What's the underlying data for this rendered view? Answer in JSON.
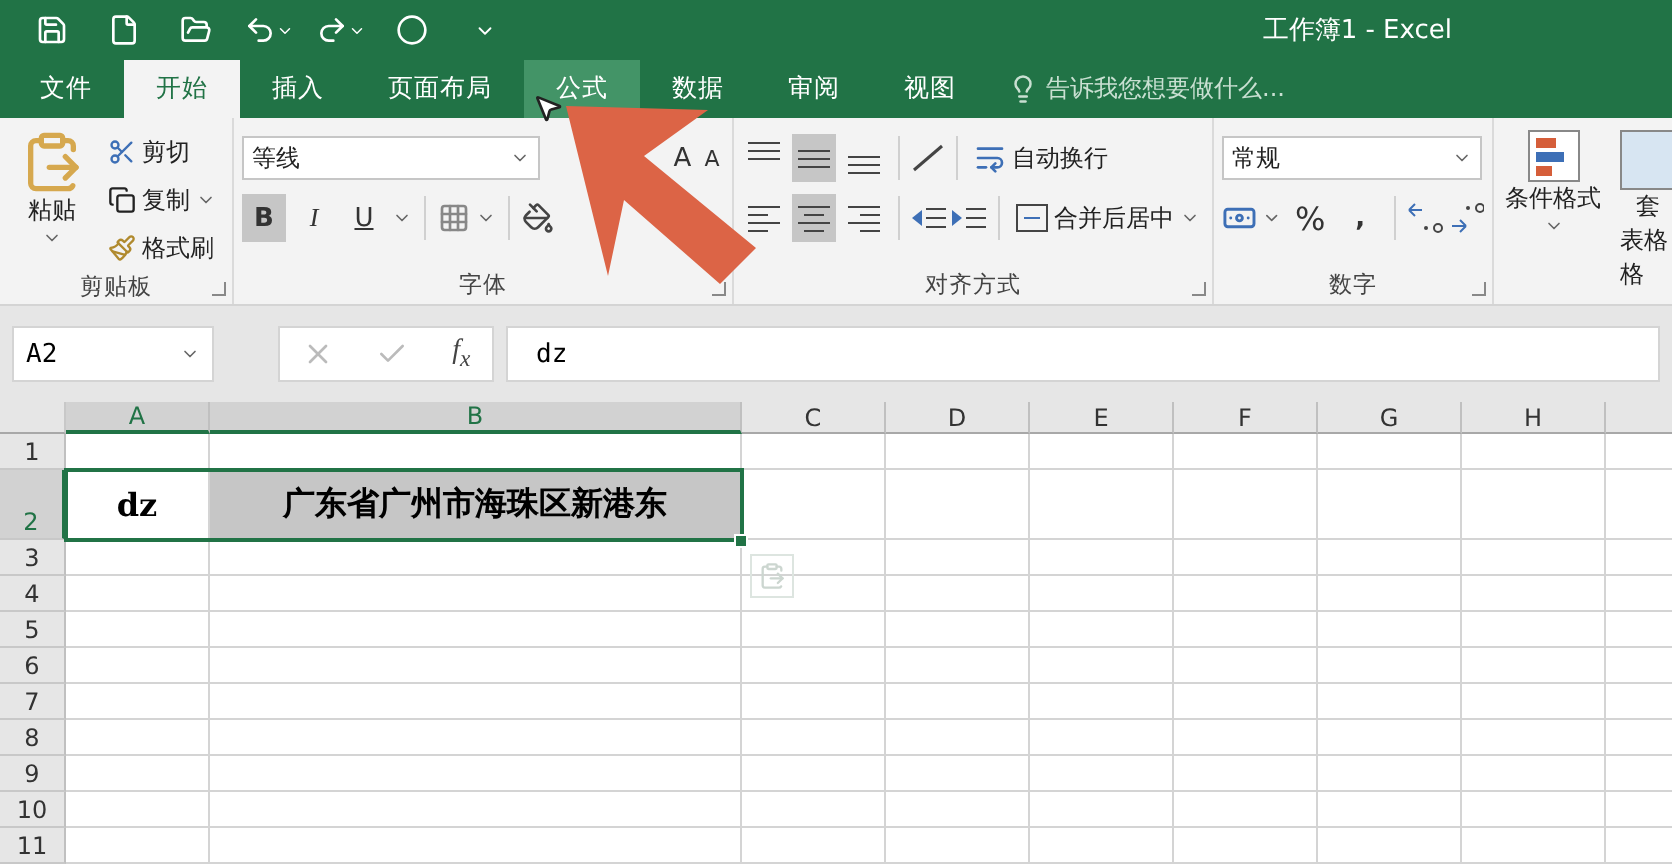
{
  "window": {
    "title": "工作簿1 - Excel"
  },
  "tabs": [
    {
      "label": "文件",
      "selected": false,
      "hovered": false
    },
    {
      "label": "开始",
      "selected": true,
      "hovered": false
    },
    {
      "label": "插入",
      "selected": false,
      "hovered": false
    },
    {
      "label": "页面布局",
      "selected": false,
      "hovered": false
    },
    {
      "label": "公式",
      "selected": false,
      "hovered": true
    },
    {
      "label": "数据",
      "selected": false,
      "hovered": false
    },
    {
      "label": "审阅",
      "selected": false,
      "hovered": false
    },
    {
      "label": "视图",
      "selected": false,
      "hovered": false
    }
  ],
  "tell_me": {
    "placeholder": "告诉我您想要做什么..."
  },
  "clipboard": {
    "title": "剪贴板",
    "paste": "粘贴",
    "cut": "剪切",
    "copy": "复制",
    "format_painter": "格式刷"
  },
  "font": {
    "title": "字体",
    "font_name": "等线",
    "grow": "A",
    "shrink": "A",
    "bold": "B",
    "italic": "I",
    "underline": "U",
    "bold_on": true
  },
  "alignment": {
    "title": "对齐方式",
    "wrap_text": "自动换行",
    "merge_center": "合并后居中",
    "vertical": [
      {
        "kind": "top",
        "selected": false
      },
      {
        "kind": "middle",
        "selected": true
      },
      {
        "kind": "bottom",
        "selected": false
      }
    ],
    "horizontal": [
      {
        "kind": "left",
        "selected": false
      },
      {
        "kind": "center",
        "selected": true
      },
      {
        "kind": "right",
        "selected": false
      }
    ]
  },
  "number": {
    "title": "数字",
    "format": "常规",
    "percent": "%",
    "comma": ","
  },
  "styles": {
    "conditional": "条件格式",
    "table_line1": "套",
    "table_line2": "表格格"
  },
  "name_box": "A2",
  "fx": "f$_{x}$",
  "formula": "dz",
  "sheet": {
    "columns": [
      {
        "label": "A",
        "selected": true
      },
      {
        "label": "B",
        "selected": true
      },
      {
        "label": "C",
        "selected": false
      },
      {
        "label": "D",
        "selected": false
      },
      {
        "label": "E",
        "selected": false
      },
      {
        "label": "F",
        "selected": false
      },
      {
        "label": "G",
        "selected": false
      },
      {
        "label": "H",
        "selected": false
      }
    ],
    "rows": [
      {
        "label": "1",
        "selected": false,
        "cells": []
      },
      {
        "label": "2",
        "selected": true,
        "cells": [
          {
            "text": "dz",
            "highlighted": false
          },
          {
            "text": "广东省广州市海珠区新港东",
            "highlighted": true
          }
        ]
      },
      {
        "label": "3",
        "selected": false,
        "cells": []
      },
      {
        "label": "4",
        "selected": false,
        "cells": []
      },
      {
        "label": "5",
        "selected": false,
        "cells": []
      },
      {
        "label": "6",
        "selected": false,
        "cells": []
      },
      {
        "label": "7",
        "selected": false,
        "cells": []
      },
      {
        "label": "8",
        "selected": false,
        "cells": []
      },
      {
        "label": "9",
        "selected": false,
        "cells": []
      },
      {
        "label": "10",
        "selected": false,
        "cells": []
      },
      {
        "label": "11",
        "selected": false,
        "cells": []
      }
    ]
  }
}
